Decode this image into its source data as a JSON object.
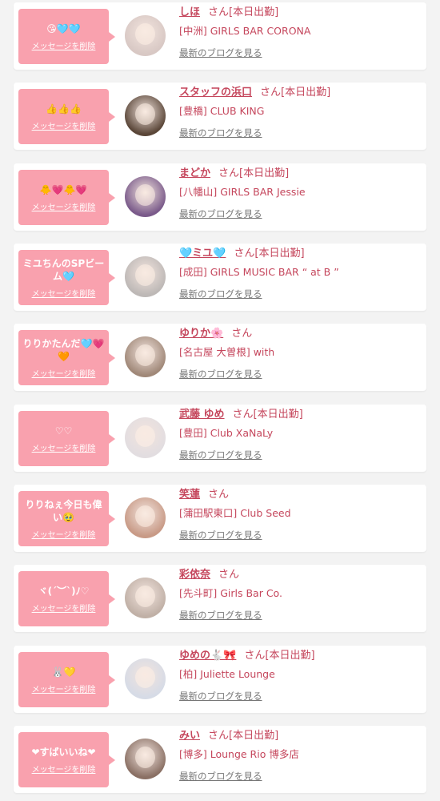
{
  "items": [
    {
      "message": "😘🩵🩵",
      "delete_label": "メッセージを削除",
      "name": "しほ",
      "suffix": "さん[本日出勤]",
      "shop": "[中洲] GIRLS BAR CORONA",
      "blog_label": "最新のブログを見る",
      "avatar_bg": "#d8c8c4"
    },
    {
      "message": "👍👍👍",
      "delete_label": "メッセージを削除",
      "name": "スタッフの浜口",
      "suffix": "さん[本日出勤]",
      "shop": "[豊橋] CLUB KING",
      "blog_label": "最新のブログを見る",
      "avatar_bg": "#5a4638"
    },
    {
      "message": "🐥💗🐥💗",
      "delete_label": "メッセージを削除",
      "name": "まどか",
      "suffix": "さん[本日出勤]",
      "shop": "[八幡山] GIRLS BAR Jessie",
      "blog_label": "最新のブログを見る",
      "avatar_bg": "#7a5a8a"
    },
    {
      "message": "ミユちんのSPビーム🩵",
      "delete_label": "メッセージを削除",
      "name": "🩵ミユ🩵",
      "suffix": "さん[本日出勤]",
      "shop": "[成田] GIRLS MUSIC BAR “ at B ”",
      "blog_label": "最新のブログを見る",
      "avatar_bg": "#bdb8b6"
    },
    {
      "message": "りりかたんだ🩵💗🧡",
      "delete_label": "メッセージを削除",
      "name": "ゆりか🌸",
      "suffix": "さん",
      "shop": "[名古屋 大曽根] with",
      "blog_label": "最新のブログを見る",
      "avatar_bg": "#a08878"
    },
    {
      "message": "♡♡",
      "delete_label": "メッセージを削除",
      "name": "武藤 ゆめ",
      "suffix": "さん[本日出勤]",
      "shop": "[豊田] Club XaNaLy",
      "blog_label": "最新のブログを見る",
      "avatar_bg": "#e2dde0"
    },
    {
      "message": "りりねぇ今日も偉い🥹",
      "delete_label": "メッセージを削除",
      "name": "笑蓮",
      "suffix": "さん",
      "shop": "[蒲田駅東口] Club Seed",
      "blog_label": "最新のブログを見る",
      "avatar_bg": "#c89a86"
    },
    {
      "message": "ヾ(´︶`)ﾉ♡",
      "delete_label": "メッセージを削除",
      "name": "彩依奈",
      "suffix": "さん",
      "shop": "[先斗町] Girls Bar Co.",
      "blog_label": "最新のブログを見る",
      "avatar_bg": "#c0b0a6"
    },
    {
      "message": "🐰💛",
      "delete_label": "メッセージを削除",
      "name": "ゆめの🐇🎀",
      "suffix": "さん[本日出勤]",
      "shop": "[柏] Juliette Lounge",
      "blog_label": "最新のブログを見る",
      "avatar_bg": "#d6dbe6"
    },
    {
      "message": "❤すばいいね❤",
      "delete_label": "メッセージを削除",
      "name": "みい",
      "suffix": "さん[本日出勤]",
      "shop": "[博多] Lounge Rio 博多店",
      "blog_label": "最新のブログを見る",
      "avatar_bg": "#8a7064"
    }
  ]
}
